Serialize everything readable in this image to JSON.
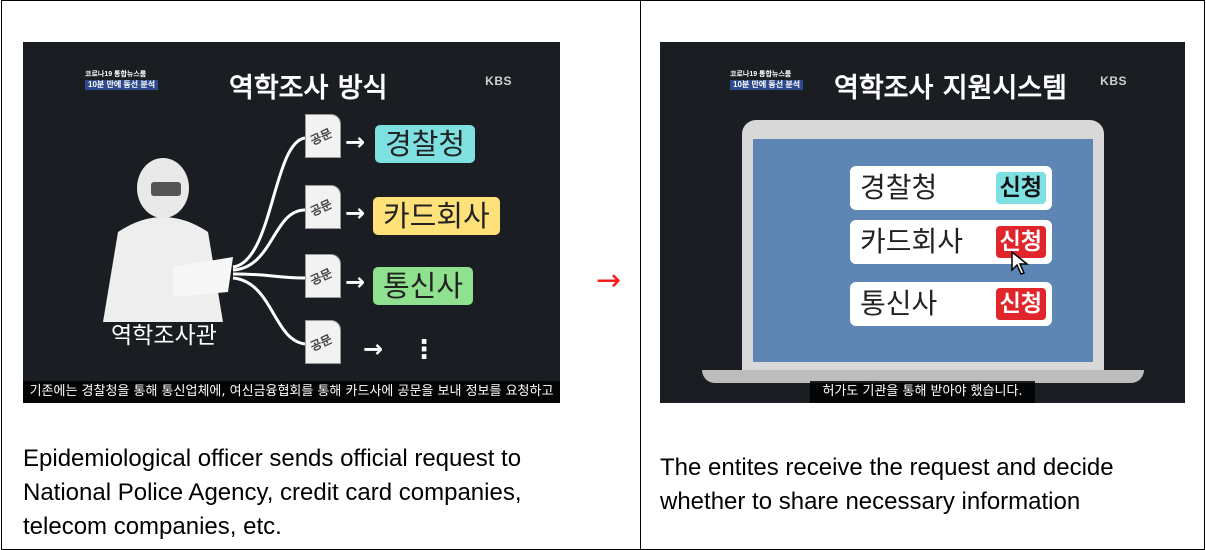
{
  "arrow": "→",
  "colors": {
    "arrow": "#ff1a1a",
    "teal": "#7ee0e0",
    "yellow": "#ffe17a",
    "green": "#8fe08f",
    "apply_red": "#e0262b",
    "screen": "#5e86b4"
  },
  "left": {
    "tag_line1": "코로나19 통합뉴스룸",
    "tag_line2": "10분 만에 동선 분석",
    "kbs": "KBS",
    "title": "역학조사 방식",
    "doc_label": "공문",
    "destinations": [
      "경찰청",
      "카드회사",
      "통신사"
    ],
    "more": "⋮",
    "officer_label": "역학조사관",
    "subtitle": "기존에는 경찰청을 통해 통신업체에, 여신금융협회를 통해 카드사에 공문을 보내 정보를 요청하고",
    "caption": "Epidemiological officer sends official request to National Police Agency, credit card companies, telecom companies, etc."
  },
  "right": {
    "tag_line1": "코로나19 통합뉴스룸",
    "tag_line2": "10분 만에 동선 분석",
    "kbs": "KBS",
    "title": "역학조사 지원시스템",
    "rows": [
      {
        "label": "경찰청",
        "button": "신청"
      },
      {
        "label": "카드회사",
        "button": "신청"
      },
      {
        "label": "통신사",
        "button": "신청"
      }
    ],
    "subtitle": "허가도 기관을 통해 받아야 했습니다.",
    "caption": "The entites receive the request and decide whether to share necessary information"
  }
}
